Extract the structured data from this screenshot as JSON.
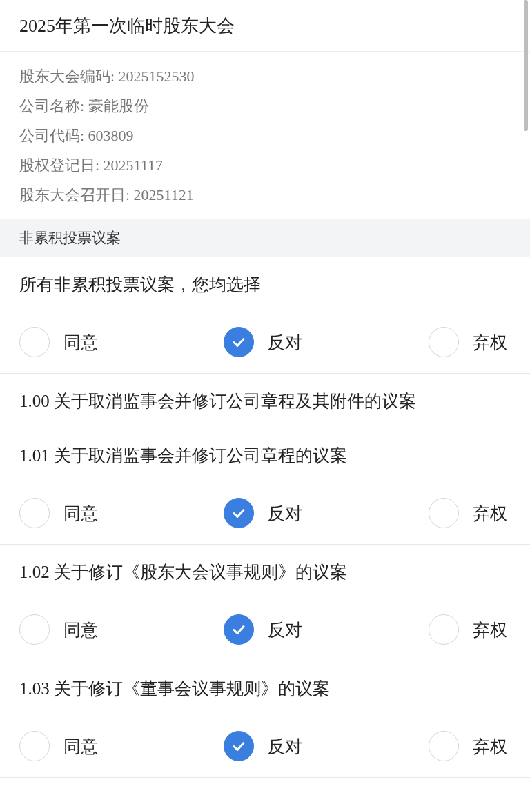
{
  "title": "2025年第一次临时股东大会",
  "info": [
    {
      "label": "股东大会编码:",
      "value": "2025152530"
    },
    {
      "label": "公司名称:",
      "value": "豪能股份"
    },
    {
      "label": "公司代码:",
      "value": "603809"
    },
    {
      "label": "股权登记日:",
      "value": "20251117"
    },
    {
      "label": "股东大会召开日:",
      "value": "20251121"
    }
  ],
  "section": "非累积投票议案",
  "items": [
    {
      "kind": "vote",
      "title": "所有非累积投票议案，您均选择",
      "options": [
        {
          "label": "同意",
          "selected": false
        },
        {
          "label": "反对",
          "selected": true
        },
        {
          "label": "弃权",
          "selected": false
        }
      ]
    },
    {
      "kind": "header",
      "title": "1.00 关于取消监事会并修订公司章程及其附件的议案"
    },
    {
      "kind": "vote",
      "title": "1.01 关于取消监事会并修订公司章程的议案",
      "options": [
        {
          "label": "同意",
          "selected": false
        },
        {
          "label": "反对",
          "selected": true
        },
        {
          "label": "弃权",
          "selected": false
        }
      ]
    },
    {
      "kind": "vote",
      "title": "1.02 关于修订《股东大会议事规则》的议案",
      "options": [
        {
          "label": "同意",
          "selected": false
        },
        {
          "label": "反对",
          "selected": true
        },
        {
          "label": "弃权",
          "selected": false
        }
      ]
    },
    {
      "kind": "vote",
      "title": "1.03 关于修订《董事会议事规则》的议案",
      "options": [
        {
          "label": "同意",
          "selected": false
        },
        {
          "label": "反对",
          "selected": true
        },
        {
          "label": "弃权",
          "selected": false
        }
      ]
    }
  ]
}
